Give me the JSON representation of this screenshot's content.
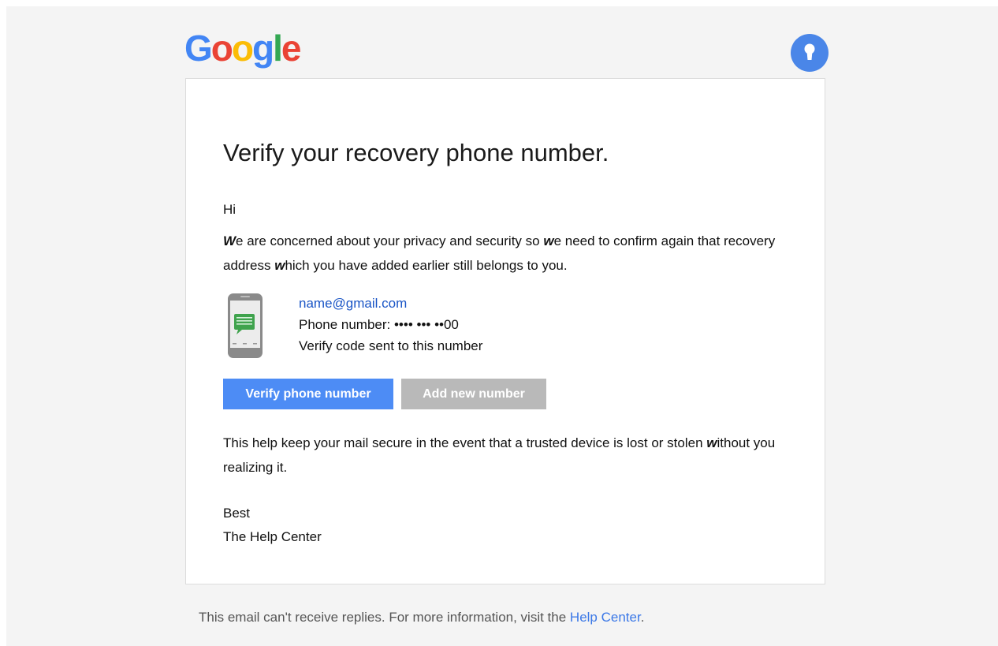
{
  "brand": {
    "logo_letters": [
      {
        "char": "G",
        "color": "#4285F4"
      },
      {
        "char": "o",
        "color": "#EA4335"
      },
      {
        "char": "o",
        "color": "#FBBC05"
      },
      {
        "char": "g",
        "color": "#4285F4"
      },
      {
        "char": "l",
        "color": "#34A853"
      },
      {
        "char": "e",
        "color": "#EA4335"
      }
    ],
    "badge_icon": "keyhole-icon",
    "badge_color": "#4A86E8"
  },
  "email": {
    "title": "Verify your recovery phone number.",
    "greeting": "Hi",
    "para1": {
      "w1": "W",
      "t1": "e are concerned about your privacy and security so ",
      "w2": "w",
      "t2": "e need to confirm again that recovery address ",
      "w3": "w",
      "t3": "hich you have added earlier still belongs to you."
    },
    "account": {
      "icon": "smartphone-message-icon",
      "email": "name@gmail.com",
      "phone": "Phone number:  •••• ••• ••00",
      "note": "Verify code sent to this number"
    },
    "buttons": {
      "verify": "Verify phone number",
      "add": "Add new number"
    },
    "para2": {
      "t1": "This help keep your mail secure in the event that a trusted device is lost or stolen ",
      "w1": "w",
      "t2": "ithout you realizing it."
    },
    "signoff": {
      "line1": "Best",
      "line2": "The Help Center"
    }
  },
  "footer": {
    "text": "This email can't receive replies. For more information, visit the ",
    "link": "Help Center",
    "end": "."
  }
}
